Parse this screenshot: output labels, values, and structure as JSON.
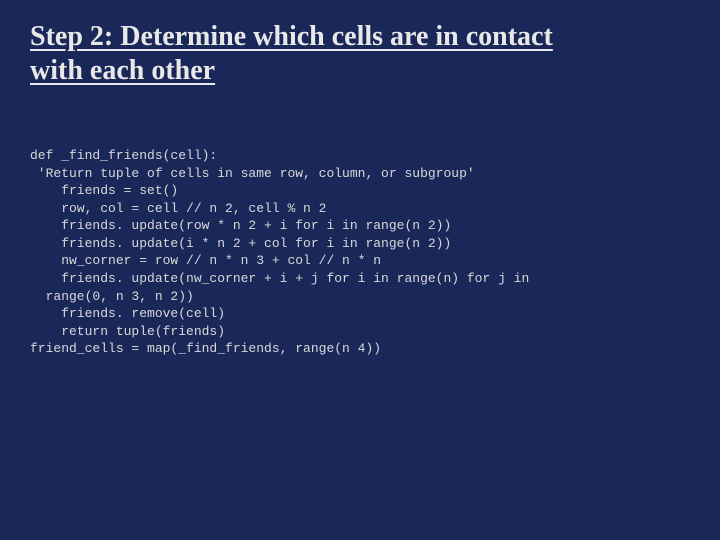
{
  "title_line1": "Step 2:  Determine which cells are in contact",
  "title_line2": "with each other",
  "code": "def _find_friends(cell):\n 'Return tuple of cells in same row, column, or subgroup'\n    friends = set()\n    row, col = cell // n 2, cell % n 2\n    friends. update(row * n 2 + i for i in range(n 2))\n    friends. update(i * n 2 + col for i in range(n 2))\n    nw_corner = row // n * n 3 + col // n * n\n    friends. update(nw_corner + i + j for i in range(n) for j in\n  range(0, n 3, n 2))\n    friends. remove(cell)\n    return tuple(friends)\nfriend_cells = map(_find_friends, range(n 4))"
}
